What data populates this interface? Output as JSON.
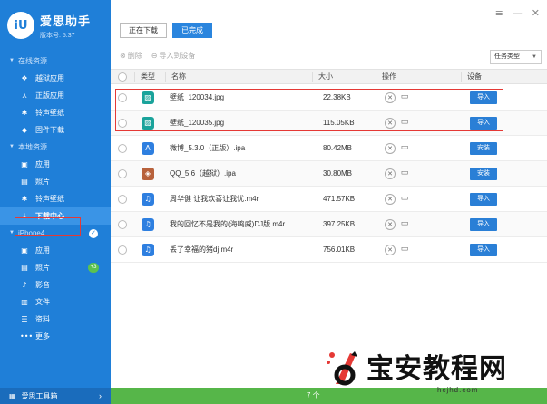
{
  "app": {
    "name": "爱思助手",
    "version": "版本号: 5.37",
    "logo_text": "iU"
  },
  "sidebar": {
    "sections": [
      {
        "title": "在线资源",
        "items": [
          {
            "label": "越狱应用",
            "icon": "layers-icon"
          },
          {
            "label": "正版应用",
            "icon": "appstore-icon"
          },
          {
            "label": "铃声壁纸",
            "icon": "puzzle-icon"
          },
          {
            "label": "固件下载",
            "icon": "box-icon"
          }
        ]
      },
      {
        "title": "本地资源",
        "items": [
          {
            "label": "应用",
            "icon": "apps-icon"
          },
          {
            "label": "照片",
            "icon": "photo-icon"
          },
          {
            "label": "铃声壁纸",
            "icon": "puzzle-icon"
          },
          {
            "label": "下载中心",
            "icon": "download-icon",
            "active": true
          }
        ]
      },
      {
        "title": "iPhone4",
        "items": [
          {
            "label": "应用",
            "icon": "apps-icon"
          },
          {
            "label": "照片",
            "icon": "photo-icon",
            "badge": "+3"
          },
          {
            "label": "影音",
            "icon": "music-icon"
          },
          {
            "label": "文件",
            "icon": "file-icon"
          },
          {
            "label": "资料",
            "icon": "list-icon"
          },
          {
            "label": "更多",
            "icon": "more-icon"
          }
        ]
      }
    ],
    "footer_label": "爱思工具箱"
  },
  "tabs": {
    "downloading": "正在下载",
    "completed": "已完成"
  },
  "toolbar": {
    "delete_label": "删除",
    "import_label": "导入到设备"
  },
  "task_filter": "任务类型",
  "table": {
    "headers": {
      "type": "类型",
      "name": "名称",
      "size": "大小",
      "op": "操作",
      "device": "设备"
    },
    "rows": [
      {
        "name": "壁纸_120034.jpg",
        "size": "22.38KB",
        "kind": "image",
        "action": "导入"
      },
      {
        "name": "壁纸_120035.jpg",
        "size": "115.05KB",
        "kind": "image",
        "action": "导入"
      },
      {
        "name": "微博_5.3.0（正版）.ipa",
        "size": "80.42MB",
        "kind": "appstore",
        "action": "安装"
      },
      {
        "name": "QQ_5.6（越狱）.ipa",
        "size": "30.80MB",
        "kind": "jailbreak",
        "action": "安装"
      },
      {
        "name": "周华健 让我欢喜让我忧.m4r",
        "size": "471.57KB",
        "kind": "ringtone",
        "action": "导入"
      },
      {
        "name": "我的回忆不是我的(海鸣威)DJ版.m4r",
        "size": "397.25KB",
        "kind": "ringtone",
        "action": "导入"
      },
      {
        "name": "丢了幸福的猪dj.m4r",
        "size": "756.01KB",
        "kind": "ringtone",
        "action": "导入"
      }
    ]
  },
  "footer_count": "7 个",
  "watermark": {
    "title": "宝安教程网",
    "url": "hcjhd.com"
  },
  "colors": {
    "sidebar": "#1f7fd8",
    "accent": "#2a85de",
    "footer_green": "#56b649",
    "highlight": "#e53935"
  }
}
